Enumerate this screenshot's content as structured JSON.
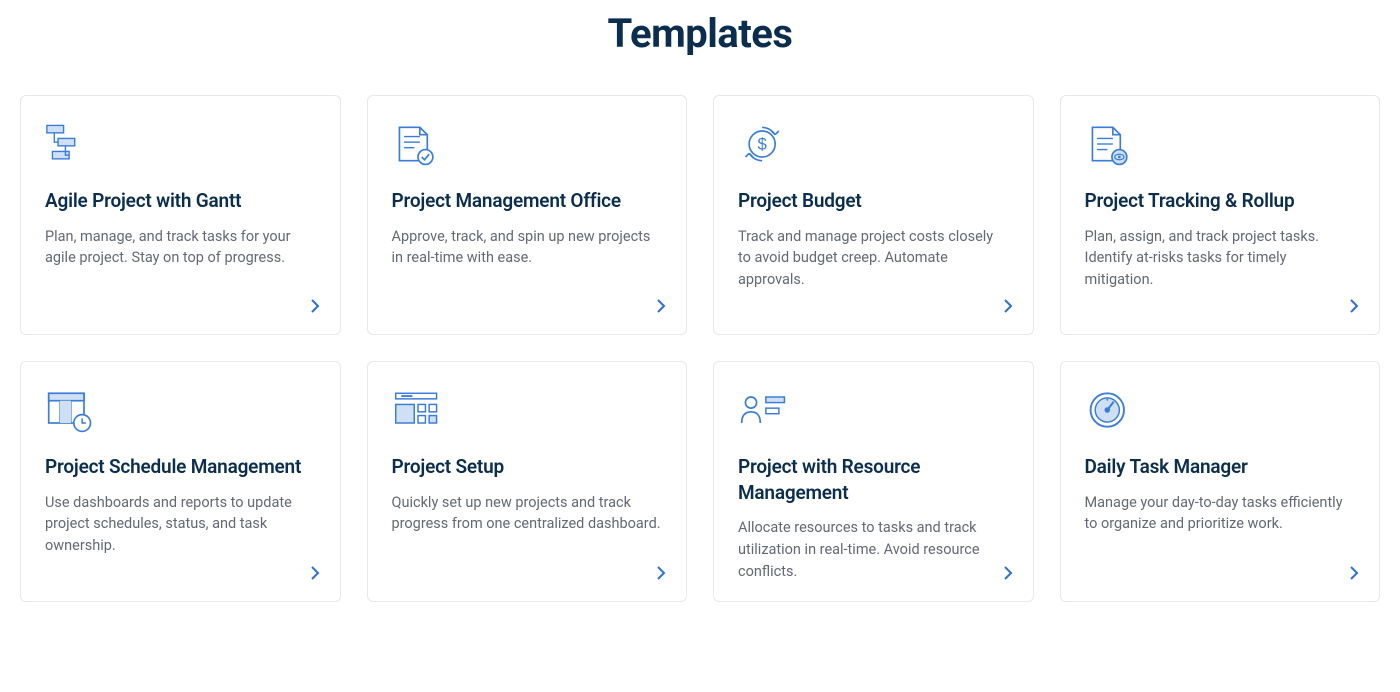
{
  "title": "Templates",
  "colors": {
    "heading": "#0b2e4f",
    "body": "#636a74",
    "accent": "#2d72d2",
    "iconFill": "#cfe0f5",
    "iconStroke": "#3b7dd8",
    "border": "#e8e8e8"
  },
  "cards": [
    {
      "icon": "gantt-icon",
      "title": "Agile Project with Gantt",
      "desc": "Plan, manage, and track tasks for your agile project. Stay on top of progress."
    },
    {
      "icon": "document-check-icon",
      "title": "Project Management Office",
      "desc": "Approve, track, and spin up new projects in real-time with ease."
    },
    {
      "icon": "dollar-cycle-icon",
      "title": "Project Budget",
      "desc": "Track and manage project costs closely to avoid budget creep. Automate approvals."
    },
    {
      "icon": "document-eye-icon",
      "title": "Project Tracking & Rollup",
      "desc": "Plan, assign, and track project tasks. Identify at-risks tasks for timely mitigation."
    },
    {
      "icon": "schedule-clock-icon",
      "title": "Project Schedule Management",
      "desc": "Use dashboards and reports to update project schedules, status, and task ownership."
    },
    {
      "icon": "dashboard-tiles-icon",
      "title": "Project Setup",
      "desc": "Quickly set up new projects and track progress from one centralized dashboard."
    },
    {
      "icon": "person-resource-icon",
      "title": "Project with Resource Management",
      "desc": "Allocate resources to tasks and track utilization in real-time. Avoid resource conflicts."
    },
    {
      "icon": "gauge-icon",
      "title": "Daily Task Manager",
      "desc": "Manage your day-to-day tasks efficiently to organize and prioritize work."
    }
  ]
}
